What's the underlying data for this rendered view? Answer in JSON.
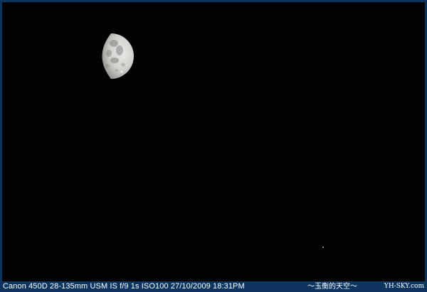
{
  "photo": {
    "subject": "",
    "background_color": "#020203",
    "frame_color": "#0d3560"
  },
  "caption": {
    "exif": "Canon 450D   28-135mm USM IS   f/9  1s  ISO100    27/10/2009  18:31PM",
    "signature": "～玉衡的天空～",
    "site": "YH-SKY.com"
  }
}
